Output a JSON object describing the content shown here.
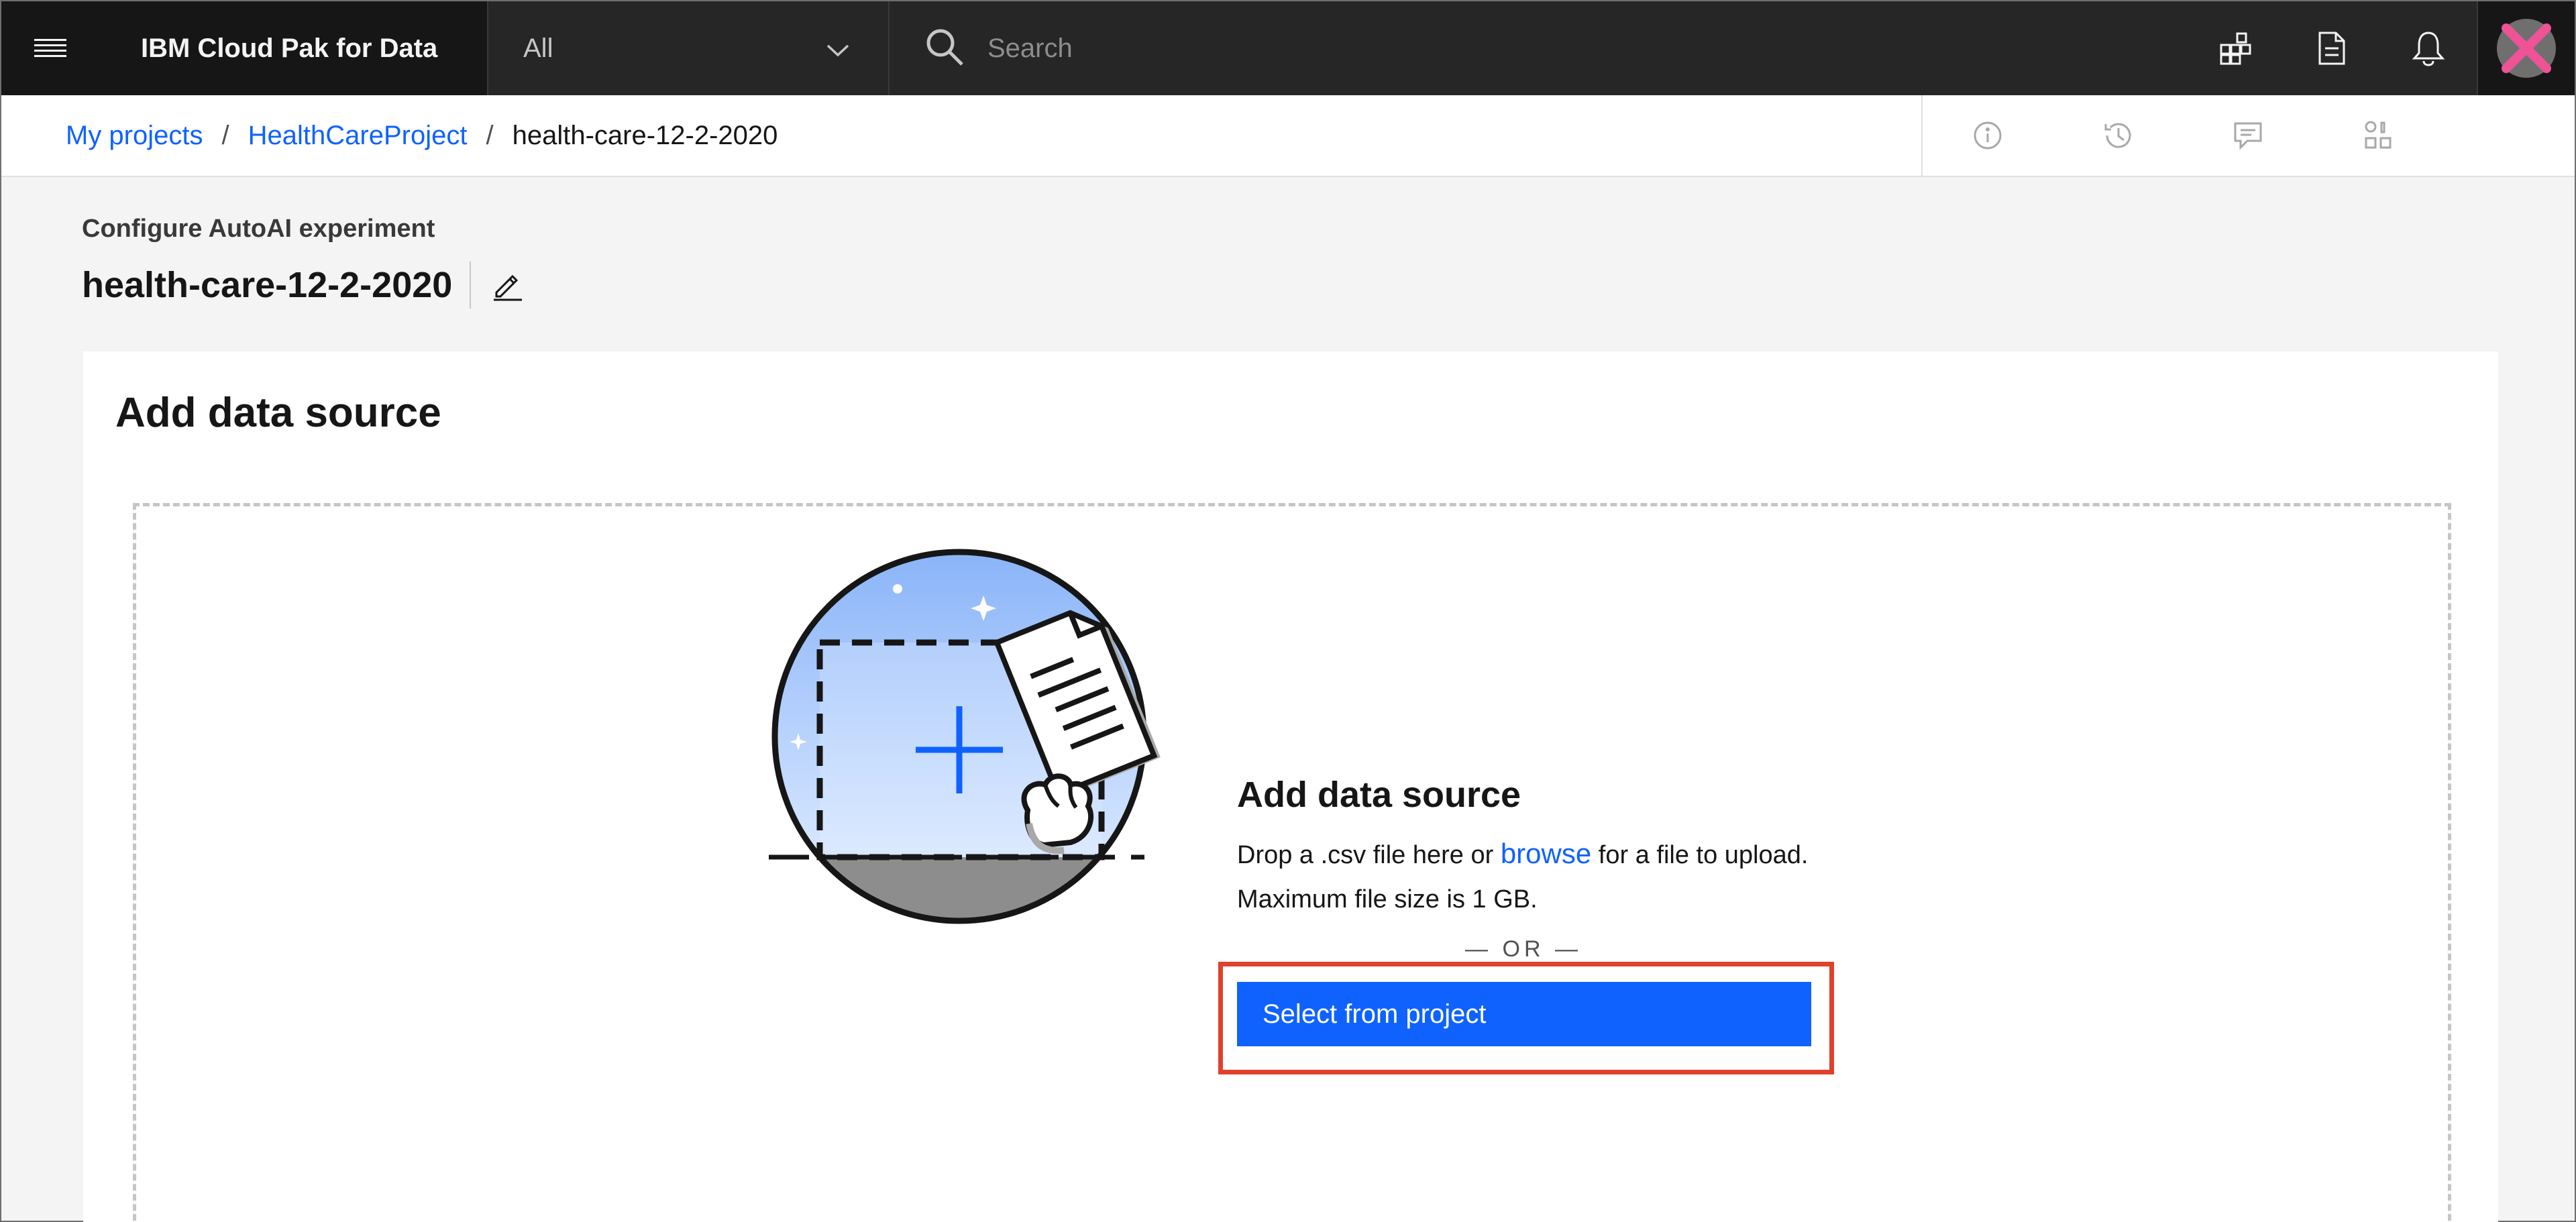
{
  "topbar": {
    "brand": "IBM Cloud Pak for Data",
    "scope_selected": "All",
    "search_placeholder": "Search",
    "icons": [
      "menu-icon",
      "apps-icon",
      "document-icon",
      "notification-icon",
      "close-icon"
    ],
    "accent_color": "#ee5396"
  },
  "breadcrumb": {
    "items": [
      {
        "label": "My projects"
      },
      {
        "label": "HealthCareProject"
      },
      {
        "label": "health-care-12-2-2020"
      }
    ],
    "separator": "/"
  },
  "toolbar": {
    "icons": [
      "information-icon",
      "history-icon",
      "comment-icon",
      "assets-icon"
    ]
  },
  "page": {
    "subtitle": "Configure AutoAI experiment",
    "title": "health-care-12-2-2020"
  },
  "card": {
    "title": "Add data source",
    "dropzone": {
      "heading": "Add data source",
      "desc_before": "Drop a .csv file here or ",
      "browse_link": "browse",
      "desc_after": " for a file to upload. Maximum file size is 1 GB.",
      "or_label": "— OR —",
      "select_button": "Select from project"
    }
  },
  "colors": {
    "primary": "#0f62fe",
    "highlight": "#e0412b",
    "topbar": "#161616"
  }
}
